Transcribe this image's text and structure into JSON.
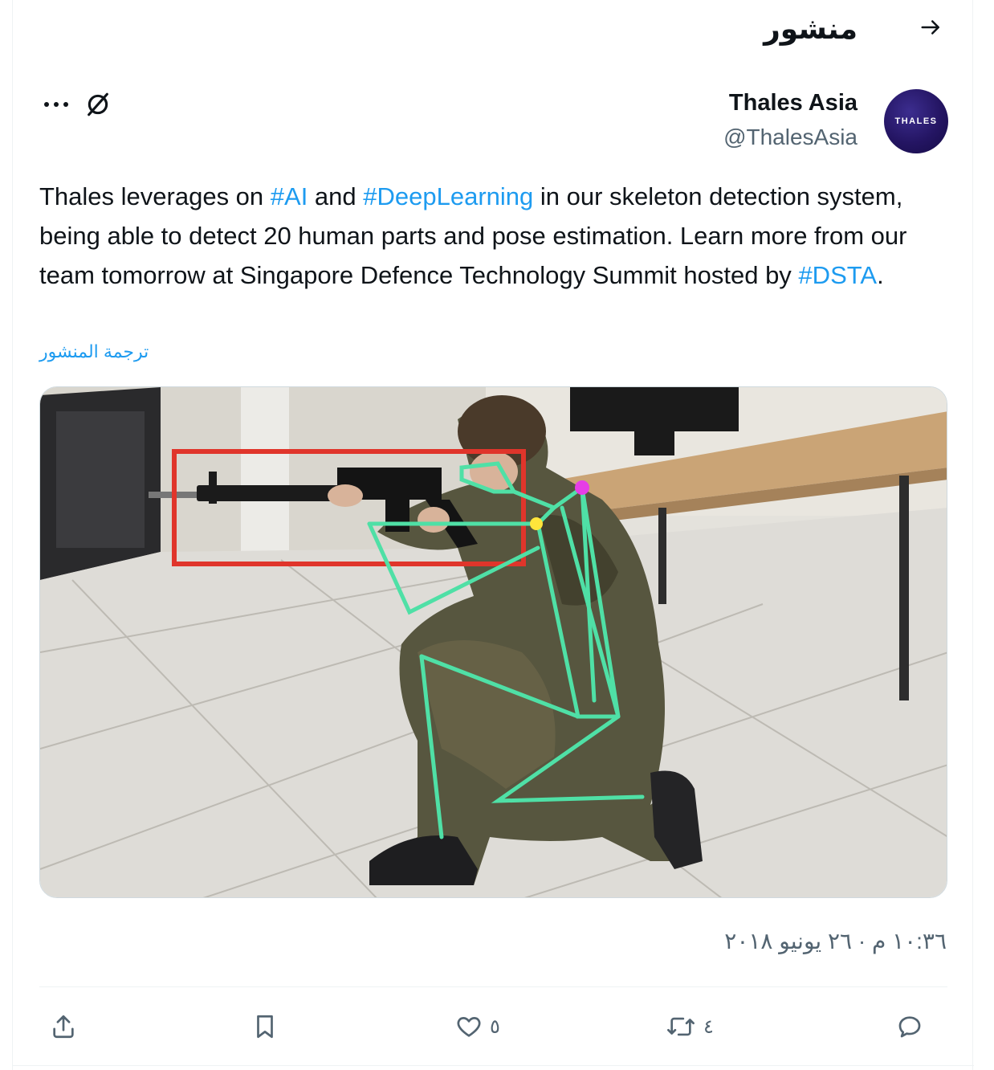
{
  "header": {
    "title": "منشور",
    "back_icon": "arrow-right-icon"
  },
  "author": {
    "name": "Thales Asia",
    "handle": "@ThalesAsia",
    "avatar_text": "THALES"
  },
  "tweet": {
    "text_parts": [
      {
        "text": "Thales leverages on ",
        "tag": false
      },
      {
        "text": "#AI",
        "tag": true
      },
      {
        "text": " and ",
        "tag": false
      },
      {
        "text": "#DeepLearning",
        "tag": true
      },
      {
        "text": " in our skeleton detection system, being able to detect 20 human parts and pose estimation. Learn more from our team tomorrow at Singapore Defence Technology Summit hosted by ",
        "tag": false
      },
      {
        "text": "#DSTA",
        "tag": true
      },
      {
        "text": ".",
        "tag": false
      }
    ],
    "translate_label": "ترجمة المنشور",
    "timestamp": "١٠:٣٦ م · ٢٦ يونيو ٢٠١٨"
  },
  "actions": {
    "reply_count": "",
    "retweet_count": "٤",
    "like_count": "٥",
    "bookmark_count": "",
    "share_count": ""
  },
  "colors": {
    "link": "#1d9bf0",
    "secondary_text": "#536471",
    "skeleton": "#4fe0a6",
    "detection_box": "#e0352b"
  }
}
